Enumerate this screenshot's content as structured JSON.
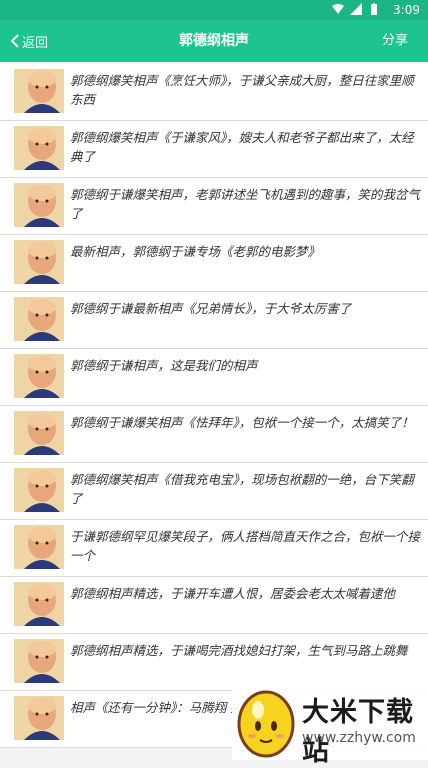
{
  "statusbar": {
    "time": "3:09"
  },
  "header": {
    "back_label": "返回",
    "title": "郭德纲相声",
    "share_label": "分享"
  },
  "items": [
    {
      "text": "郭德纲爆笑相声《烹饪大师》，于谦父亲成大厨，整日往家里顺东西"
    },
    {
      "text": " 郭德纲爆笑相声《于谦家风》，嫂夫人和老爷子都出来了，太经典了"
    },
    {
      "text": "郭德纲于谦爆笑相声，老郭讲述坐飞机遇到的趣事，笑的我岔气了"
    },
    {
      "text": "最新相声，郭德纲于谦专场《老郭的电影梦》"
    },
    {
      "text": "郭德纲于谦最新相声《兄弟情长》，于大爷太厉害了"
    },
    {
      "text": " 郭德纲于谦相声，这是我们的相声"
    },
    {
      "text": " 郭德纲于谦爆笑相声《怯拜年》，包袱一个接一个，太搞笑了！"
    },
    {
      "text": "郭德纲爆笑相声《借我充电宝》，现场包袱翻的一绝，台下笑翻了"
    },
    {
      "text": " 于谦郭德纲罕见爆笑段子，俩人搭档简直天作之合，包袱一个接一个"
    },
    {
      "text": "郭德纲相声精选，于谦开车遭人恨，居委会老太太喊着逮他"
    },
    {
      "text": "郭德纲相声精选，于谦喝完酒找媳妇打架，生气到马路上跳舞"
    },
    {
      "text": "相声《还有一分钟》：马腾翔 掉大牙"
    }
  ],
  "watermark": {
    "name": "大米下载站",
    "url": "www.zzhyw.com"
  }
}
